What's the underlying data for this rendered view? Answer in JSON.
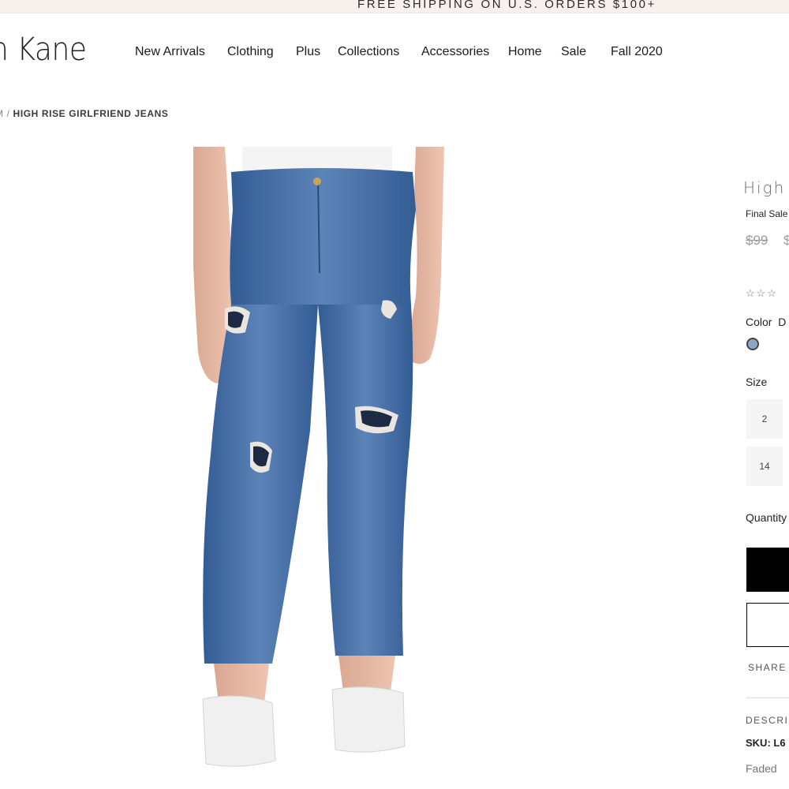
{
  "banner": {
    "text": "FREE SHIPPING ON U.S. ORDERS $100+"
  },
  "brand": {
    "logo_text": "n Kane"
  },
  "nav": {
    "items": [
      {
        "label": "New Arrivals"
      },
      {
        "label": "Clothing"
      },
      {
        "label": "Plus"
      },
      {
        "label": "Collections"
      },
      {
        "label": "Accessories"
      },
      {
        "label": "Home"
      },
      {
        "label": "Sale"
      },
      {
        "label": "Fall 2020"
      }
    ]
  },
  "breadcrumb": {
    "parent": "M",
    "separator": "/",
    "current": "HIGH RISE GIRLFRIEND JEANS"
  },
  "product": {
    "title": "High F",
    "final_sale": "Final Sale",
    "price_original": "$99",
    "price_sale": "$",
    "rating_stars": "☆☆☆",
    "color_label": "Color",
    "color_value": "D",
    "swatch_color": "#8fa9c4",
    "size_label": "Size",
    "sizes": [
      "2",
      "14"
    ],
    "quantity_label": "Quantity",
    "share_label": "SHARE",
    "description_heading": "DESCRIF",
    "sku_label": "SKU:",
    "sku_value": "L6",
    "description_text": "Faded"
  },
  "colors": {
    "banner_bg": "#f7f0ec",
    "denim": "#3f68a0",
    "add_to_bag_bg": "#000000"
  }
}
